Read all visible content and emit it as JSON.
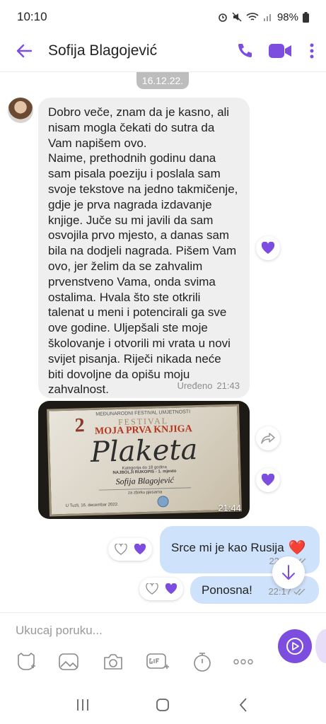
{
  "status_bar": {
    "time": "10:10",
    "battery": "98%",
    "icons": [
      "alarm-icon",
      "mute-icon",
      "wifi-icon",
      "signal-icon",
      "battery-icon"
    ]
  },
  "header": {
    "contact_name": "Sofija Blagojević",
    "icons": [
      "back-arrow-icon",
      "phone-icon",
      "video-icon",
      "more-icon"
    ],
    "accent_color": "#7c4dde"
  },
  "date_chip": "16.12.22.",
  "messages": [
    {
      "direction": "incoming",
      "text": "Dobro veče, znam da je kasno, ali nisam mogla čekati do sutra da Vam napišem ovo.\nNaime, prethodnih godinu dana sam pisala poeziju i poslala sam svoje tekstove na jedno takmičenje, gdje je prva nagrada izdavanje knjige. Juče su mi javili da sam osvojila prvo mjesto, a danas sam bila na dodjeli nagrada. Pišem Vam ovo, jer želim da se zahvalim prvenstveno Vama, onda svima ostalima. Hvala što ste otkrili talenat u meni i potencirali ga sve ove godine. Uljepšali ste moje školovanje i otvorili mi vrata u novi svijet pisanja. Riječi nikada neće biti dovoljne da opišu moju zahvalnost.",
      "edited_label": "Uređeno",
      "time": "21:43",
      "liked": true
    },
    {
      "direction": "incoming",
      "type": "image",
      "time": "21:44",
      "liked": true,
      "image_text": {
        "header": "MEĐUNARODNI FESTIVAL UMJETNOSTI",
        "number": "2",
        "festival": "FESTIVAL",
        "title": "MOJA PRVA KNJIGA",
        "main": "Plaketa",
        "category": "Kategorija do 18 godina",
        "award": "NAJBOLJI RUKOPIS - 1. mjesto",
        "name": "Sofija Blagojević",
        "subtitle": "za zbirku pjesama",
        "footer": "U Tuzli, 16. decembar 2022."
      }
    },
    {
      "direction": "outgoing",
      "text": "Srce mi je kao Rusija",
      "emoji": "❤️",
      "time": "22:16"
    },
    {
      "direction": "outgoing",
      "text": "Ponosna!",
      "time": "22:17"
    }
  ],
  "compose": {
    "placeholder": "Ukucaj poruku...",
    "tools": [
      "sticker-icon",
      "gallery-icon",
      "camera-icon",
      "gif-icon",
      "timer-icon",
      "more-options-icon"
    ]
  },
  "navbar": {
    "icons": [
      "recent-apps-icon",
      "home-icon",
      "back-icon"
    ]
  }
}
